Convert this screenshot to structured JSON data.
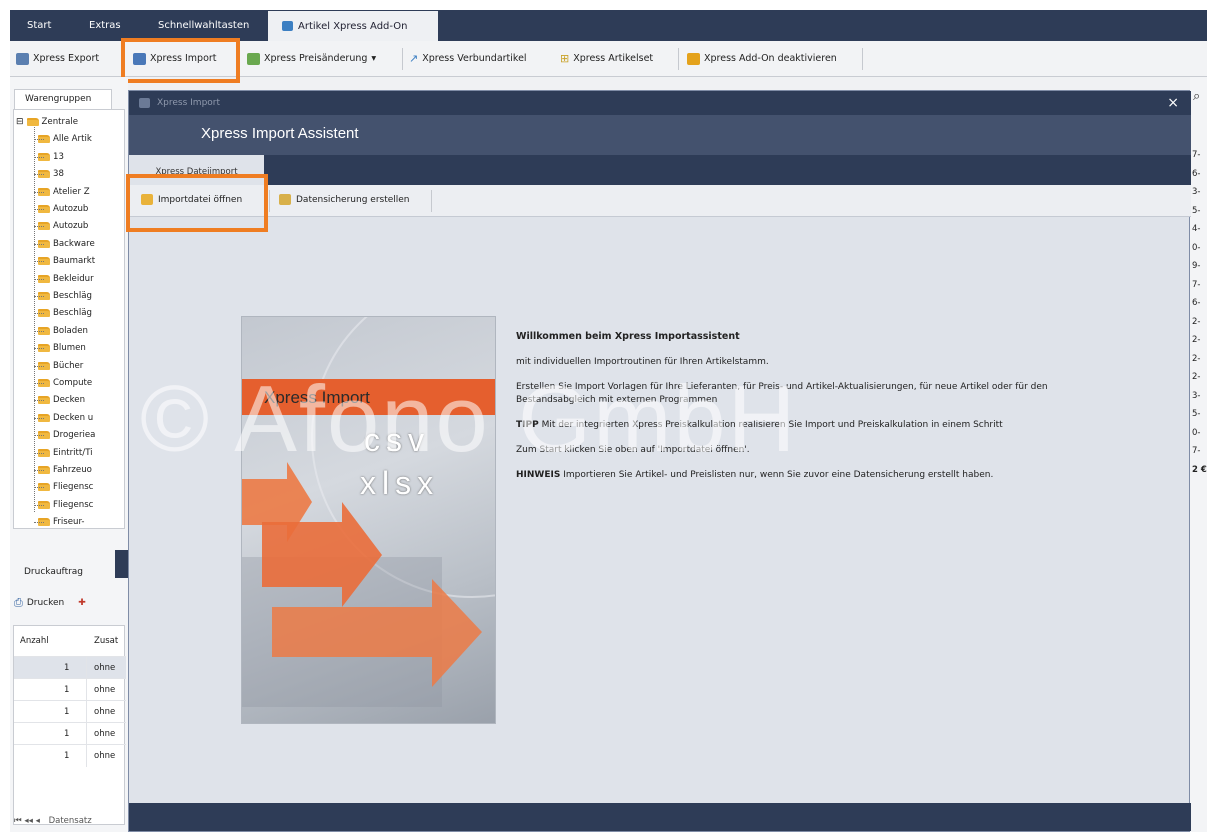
{
  "ribbon": {
    "tabs": [
      "Start",
      "Extras",
      "Schnellwahltasten",
      "Artikel Xpress Add-On"
    ],
    "active_tab": "Artikel Xpress Add-On"
  },
  "toolbar": {
    "xpress_export": "Xpress Export",
    "xpress_import": "Xpress Import",
    "xpress_preis": "Xpress Preisänderung",
    "xpress_verbund": "Xpress Verbundartikel",
    "xpress_artikelset": "Xpress Artikelset",
    "addon_deaktivieren": "Xpress Add-On deaktivieren"
  },
  "left": {
    "tab": "Warengruppen",
    "tree": [
      "Zentrale",
      "Alle Artik",
      "13",
      "38",
      "Atelier Z",
      "Autozub",
      "Autozub",
      "Backware",
      "Baumarkt",
      "Bekleidur",
      "Beschläg",
      "Beschläg",
      "Boladen",
      "Blumen",
      "Bücher",
      "Compute",
      "Decken",
      "Decken u",
      "Drogeriea",
      "Eintritt/Ti",
      "Fahrzeuo",
      "Fliegensc",
      "Fliegensc",
      "Friseur-"
    ],
    "druck_tab": "Druckauftrag",
    "drucken": "Drucken",
    "grid_headers": [
      "Anzahl",
      "Zusat"
    ],
    "grid_rows": [
      [
        "1",
        "ohne"
      ],
      [
        "1",
        "ohne"
      ],
      [
        "1",
        "ohne"
      ],
      [
        "1",
        "ohne"
      ],
      [
        "1",
        "ohne"
      ]
    ],
    "footer": "Datensatz"
  },
  "right_numbers": [
    "7-",
    "6-",
    "3-",
    "5-",
    "4-",
    "0-",
    "9-",
    "7-",
    "6-",
    "2-",
    "2-",
    "2-",
    "2-",
    "3-",
    "5-",
    "0-",
    "7-",
    "2 €"
  ],
  "dialog": {
    "window_title": "Xpress Import",
    "close": "×",
    "header": "Xpress Import Assistent",
    "tab": "Xpress Dateiimport",
    "btn_open": "Importdatei öffnen",
    "btn_backup": "Datensicherung erstellen",
    "image": {
      "title": "Xpress Import",
      "fmt1": "csv",
      "fmt2": "xlsx"
    },
    "welcome_title": "Willkommen beim Xpress Importassistent",
    "line1": "mit individuellen Importroutinen für Ihren Artikelstamm.",
    "line2": "Erstellen Sie Import Vorlagen für Ihre Lieferanten, für Preis- und Artikel-Aktualisierungen, für neue Artikel oder für den Bestandsabgleich mit externen Programmen",
    "tipp_label": "TIPP",
    "tipp_text": "Mit der integrierten Xpress Preiskalkulation realisieren Sie Import und Preiskalkulation in einem Schritt",
    "line4": "Zum Start klicken Sie oben auf 'Importdatei öffnen'.",
    "hinweis_label": "HINWEIS",
    "hinweis_text": "Importieren Sie Artikel- und Preislisten nur, wenn Sie zuvor eine Datensicherung erstellt haben."
  },
  "watermark": "© Afono GmbH",
  "colors": {
    "accent": "#ef7d22",
    "dark": "#2e3c57",
    "header": "#44526e"
  }
}
